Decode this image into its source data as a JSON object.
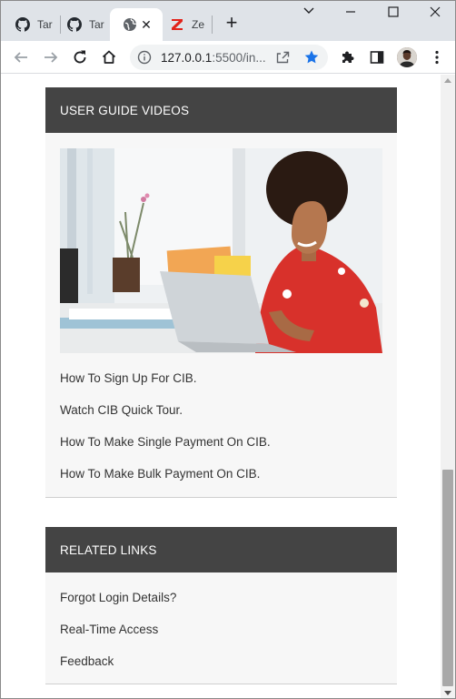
{
  "browser": {
    "tabs": [
      {
        "title": "Tar",
        "icon": "github-icon",
        "active": false
      },
      {
        "title": "Tar",
        "icon": "github-icon",
        "active": false
      },
      {
        "title": "",
        "icon": "globe-icon",
        "active": true
      },
      {
        "title": "Ze",
        "icon": "zenith-icon",
        "active": false
      }
    ],
    "url_host": "127.0.0.1",
    "url_rest": ":5500/in..."
  },
  "user_guide": {
    "heading": "USER GUIDE VIDEOS",
    "links": [
      "How To Sign Up For CIB.",
      "Watch CIB Quick Tour.",
      "How To Make Single Payment On CIB.",
      "How To Make Bulk Payment On CIB."
    ]
  },
  "related": {
    "heading": "RELATED LINKS",
    "links": [
      "Forgot Login Details?",
      "Real-Time Access",
      "Feedback"
    ]
  },
  "colors": {
    "panel_header": "#444444",
    "panel_body": "#f7f7f7",
    "star": "#1a73e8",
    "zenith_red": "#e2231a"
  }
}
